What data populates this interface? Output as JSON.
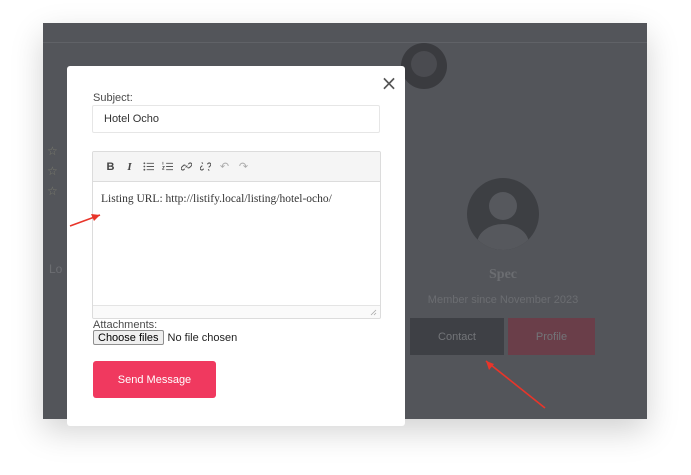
{
  "background": {
    "stars": [
      "☆",
      "☆",
      "☆"
    ],
    "left_text": "Lo",
    "profile_name": "Spec",
    "member_since": "Member since November 2023",
    "contact_label": "Contact",
    "profile_label": "Profile"
  },
  "modal": {
    "close_glyph": "×",
    "subject_label": "Subject:",
    "subject_value": "Hotel Ocho",
    "toolbar": [
      {
        "name": "bold-button",
        "glyph": "B"
      },
      {
        "name": "italic-button",
        "glyph": "I"
      },
      {
        "name": "bullet-list-button",
        "glyph": "☰"
      },
      {
        "name": "numbered-list-button",
        "glyph": "☰"
      },
      {
        "name": "link-button",
        "glyph": "link"
      },
      {
        "name": "unlink-button",
        "glyph": "unlink"
      },
      {
        "name": "undo-button",
        "glyph": "↶"
      },
      {
        "name": "redo-button",
        "glyph": "↷"
      }
    ],
    "message_text": "Listing URL: http://listify.local/listing/hotel-ocho/",
    "attachments_label": "Attachments:",
    "choose_files_label": "Choose files",
    "no_file_text": "No file chosen",
    "send_label": "Send Message"
  },
  "colors": {
    "overlay": "#53555a",
    "accent": "#f0395f",
    "arrow": "#e8352a"
  }
}
